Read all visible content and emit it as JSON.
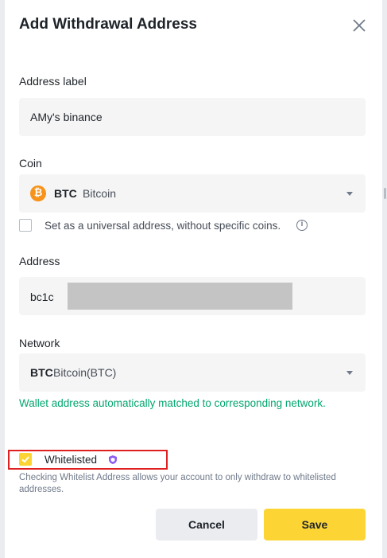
{
  "modal": {
    "title": "Add Withdrawal Address"
  },
  "address_label": {
    "label": "Address label",
    "value": "AMy's binance"
  },
  "coin": {
    "label": "Coin",
    "code": "BTC",
    "name": "Bitcoin",
    "icon": "bitcoin-icon",
    "icon_glyph": "₿",
    "icon_color": "#f7931a"
  },
  "universal": {
    "text": "Set as a universal address, without specific coins.",
    "checked": false
  },
  "address": {
    "label": "Address",
    "value": "bc1c"
  },
  "network": {
    "label": "Network",
    "code": "BTC",
    "name": "Bitcoin(BTC)",
    "match_message": "Wallet address automatically matched to corresponding network."
  },
  "whitelist": {
    "label": "Whitelisted",
    "checked": true,
    "description": "Checking Whitelist Address allows your account to only withdraw to whitelisted addresses."
  },
  "buttons": {
    "cancel": "Cancel",
    "save": "Save"
  },
  "colors": {
    "accent": "#fcd535",
    "success": "#03a66d",
    "highlight_border": "#e02020"
  }
}
